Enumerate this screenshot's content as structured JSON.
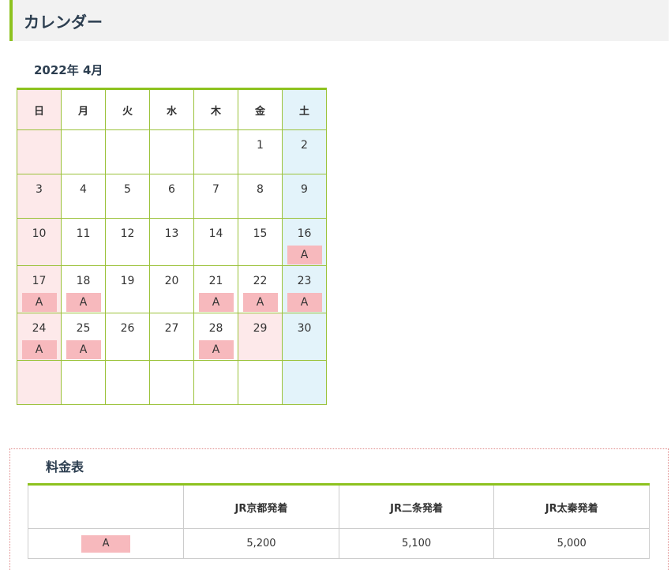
{
  "header": {
    "title": "カレンダー"
  },
  "calendar": {
    "month_label": "2022年 4月",
    "weekdays": [
      "日",
      "月",
      "火",
      "水",
      "木",
      "金",
      "土"
    ],
    "weeks": [
      [
        {
          "day": ""
        },
        {
          "day": ""
        },
        {
          "day": ""
        },
        {
          "day": ""
        },
        {
          "day": ""
        },
        {
          "day": "1"
        },
        {
          "day": "2"
        }
      ],
      [
        {
          "day": "3"
        },
        {
          "day": "4"
        },
        {
          "day": "5"
        },
        {
          "day": "6"
        },
        {
          "day": "7"
        },
        {
          "day": "8"
        },
        {
          "day": "9"
        }
      ],
      [
        {
          "day": "10"
        },
        {
          "day": "11"
        },
        {
          "day": "12"
        },
        {
          "day": "13"
        },
        {
          "day": "14"
        },
        {
          "day": "15"
        },
        {
          "day": "16",
          "badge": "A"
        }
      ],
      [
        {
          "day": "17",
          "badge": "A"
        },
        {
          "day": "18",
          "badge": "A"
        },
        {
          "day": "19"
        },
        {
          "day": "20"
        },
        {
          "day": "21",
          "badge": "A"
        },
        {
          "day": "22",
          "badge": "A"
        },
        {
          "day": "23",
          "badge": "A"
        }
      ],
      [
        {
          "day": "24",
          "badge": "A"
        },
        {
          "day": "25",
          "badge": "A"
        },
        {
          "day": "26"
        },
        {
          "day": "27"
        },
        {
          "day": "28",
          "badge": "A"
        },
        {
          "day": "29",
          "holiday": true
        },
        {
          "day": "30"
        }
      ],
      [
        {
          "day": ""
        },
        {
          "day": ""
        },
        {
          "day": ""
        },
        {
          "day": ""
        },
        {
          "day": ""
        },
        {
          "day": ""
        },
        {
          "day": ""
        }
      ]
    ],
    "colors": {
      "sunday_bg": "#fde9ea",
      "saturday_bg": "#e3f3fa",
      "holiday_bg": "#fde9ea",
      "badge_bg": "#f7b9bd",
      "accent": "#8dc21f"
    }
  },
  "price_table": {
    "title": "料金表",
    "headers": [
      "",
      "JR京都発着",
      "JR二条発着",
      "JR太秦発着"
    ],
    "rows": [
      {
        "label": "A",
        "values": [
          "5,200",
          "5,100",
          "5,000"
        ]
      }
    ]
  }
}
